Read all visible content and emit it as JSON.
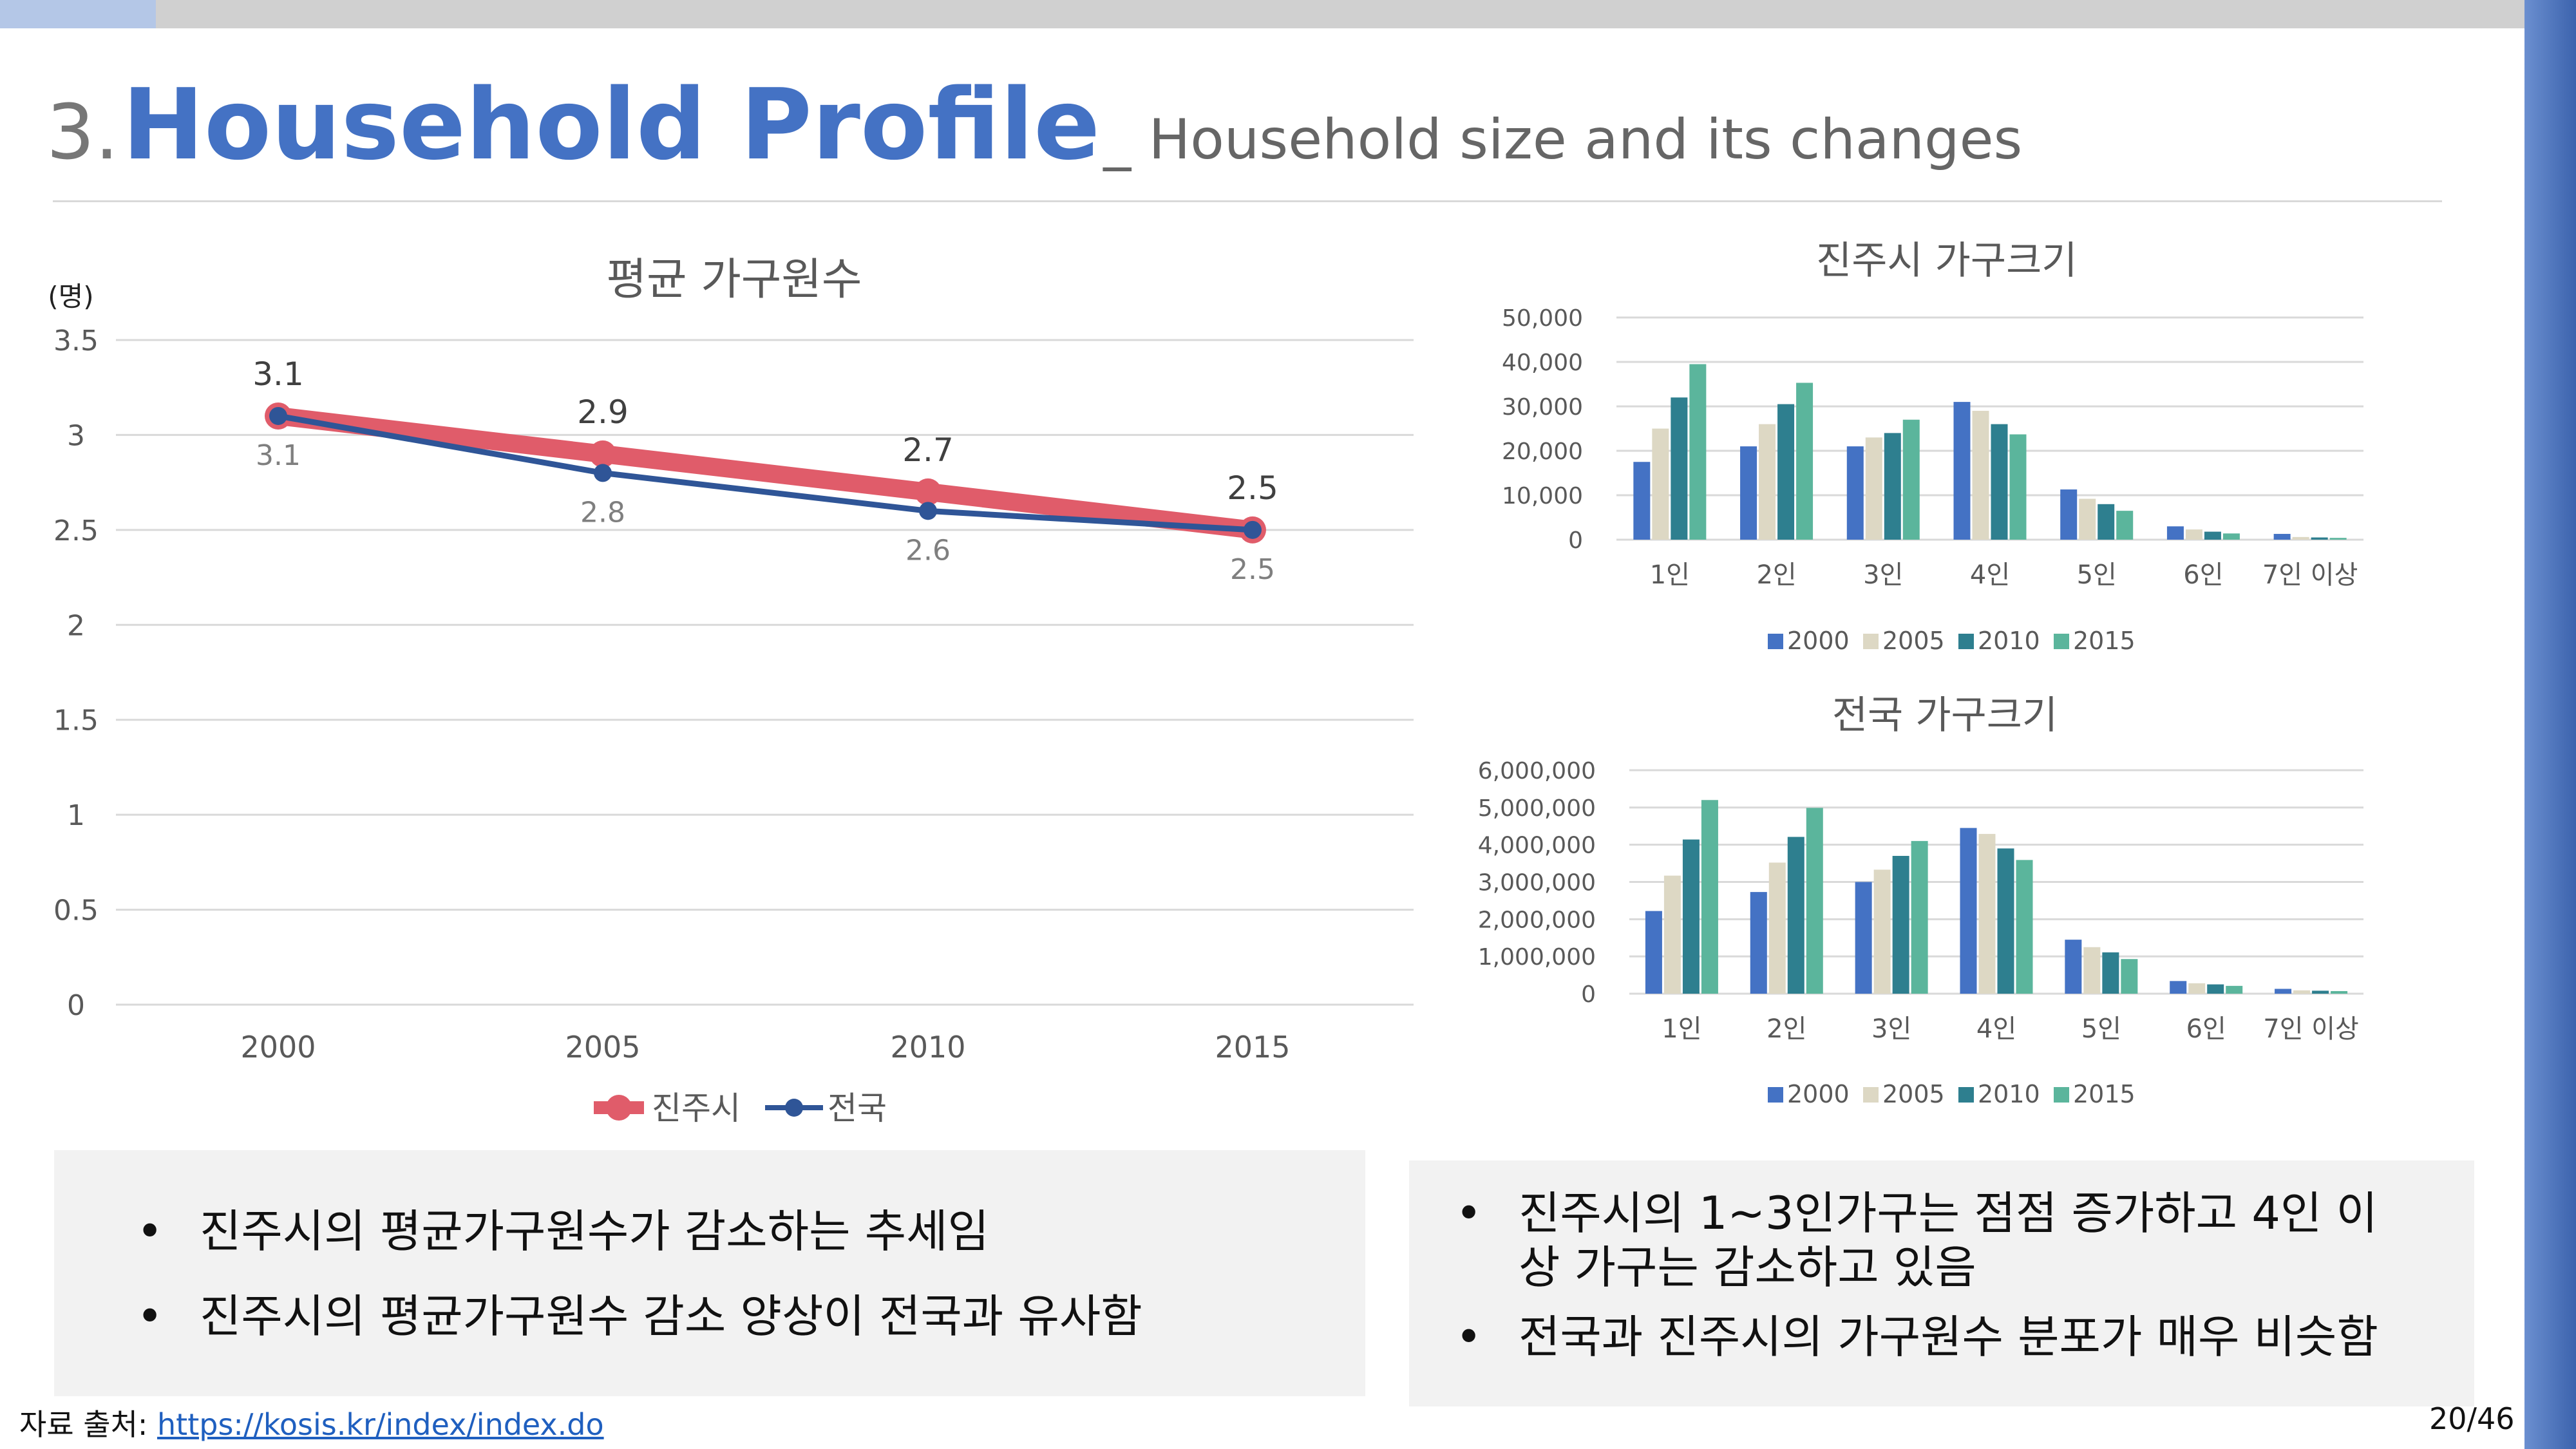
{
  "header": {
    "number": "3.",
    "title": "Household Profile",
    "subtitle": "_ Household size and its changes"
  },
  "colors": {
    "jinju": "#e05c6a",
    "national": "#2f5597",
    "y2000": "#4472c4",
    "y2005": "#ddd8c4",
    "y2010": "#2e7f8f",
    "y2015": "#5bb59c"
  },
  "chart_data": [
    {
      "type": "line",
      "title": "평균 가구원수",
      "ylabel": "(명)",
      "x": [
        "2000",
        "2005",
        "2010",
        "2015"
      ],
      "ylim": [
        0,
        3.5
      ],
      "yticks": [
        "0",
        "0.5",
        "1",
        "1.5",
        "2",
        "2.5",
        "3",
        "3.5"
      ],
      "grid": true,
      "legend": "bottom",
      "series": [
        {
          "name": "진주시",
          "values": [
            3.1,
            2.9,
            2.7,
            2.5
          ],
          "labels": [
            "3.1",
            "2.9",
            "2.7",
            "2.5"
          ]
        },
        {
          "name": "전국",
          "values": [
            3.1,
            2.8,
            2.6,
            2.5
          ],
          "labels": [
            "3.1",
            "2.8",
            "2.6",
            "2.5"
          ]
        }
      ]
    },
    {
      "type": "bar",
      "title": "진주시 가구크기",
      "categories": [
        "1인",
        "2인",
        "3인",
        "4인",
        "5인",
        "6인",
        "7인 이상"
      ],
      "ylim": [
        0,
        50000
      ],
      "yticks": [
        "0",
        "10,000",
        "20,000",
        "30,000",
        "40,000",
        "50,000"
      ],
      "grid": true,
      "legend": "bottom",
      "series": [
        {
          "name": "2000",
          "values": [
            17500,
            21000,
            21000,
            31000,
            11300,
            3000,
            1300
          ]
        },
        {
          "name": "2005",
          "values": [
            25000,
            26000,
            23000,
            29000,
            9200,
            2300,
            600
          ]
        },
        {
          "name": "2010",
          "values": [
            32000,
            30500,
            24000,
            26000,
            8000,
            1800,
            500
          ]
        },
        {
          "name": "2015",
          "values": [
            39500,
            35300,
            27000,
            23700,
            6500,
            1400,
            400
          ]
        }
      ]
    },
    {
      "type": "bar",
      "title": "전국 가구크기",
      "categories": [
        "1인",
        "2인",
        "3인",
        "4인",
        "5인",
        "6인",
        "7인 이상"
      ],
      "ylim": [
        0,
        6000000
      ],
      "yticks": [
        "0",
        "1,000,000",
        "2,000,000",
        "3,000,000",
        "4,000,000",
        "5,000,000",
        "6,000,000"
      ],
      "grid": true,
      "legend": "bottom",
      "series": [
        {
          "name": "2000",
          "values": [
            2220000,
            2730000,
            3000000,
            4450000,
            1450000,
            340000,
            130000
          ]
        },
        {
          "name": "2005",
          "values": [
            3170000,
            3520000,
            3330000,
            4290000,
            1250000,
            280000,
            90000
          ]
        },
        {
          "name": "2010",
          "values": [
            4140000,
            4210000,
            3700000,
            3900000,
            1110000,
            250000,
            80000
          ]
        },
        {
          "name": "2015",
          "values": [
            5200000,
            4990000,
            4100000,
            3590000,
            930000,
            210000,
            70000
          ]
        }
      ]
    }
  ],
  "notes_left": [
    "진주시의 평균가구원수가 감소하는 추세임",
    "진주시의 평균가구원수 감소 양상이 전국과 유사함"
  ],
  "notes_right": [
    "진주시의 1~3인가구는 점점 증가하고 4인 이상  가구는 감소하고 있음",
    "전국과 진주시의 가구원수 분포가 매우 비슷함"
  ],
  "bullet": "•",
  "source": {
    "label": "자료 출처: ",
    "link": "https://kosis.kr/index/index.do"
  },
  "page": "20/46"
}
